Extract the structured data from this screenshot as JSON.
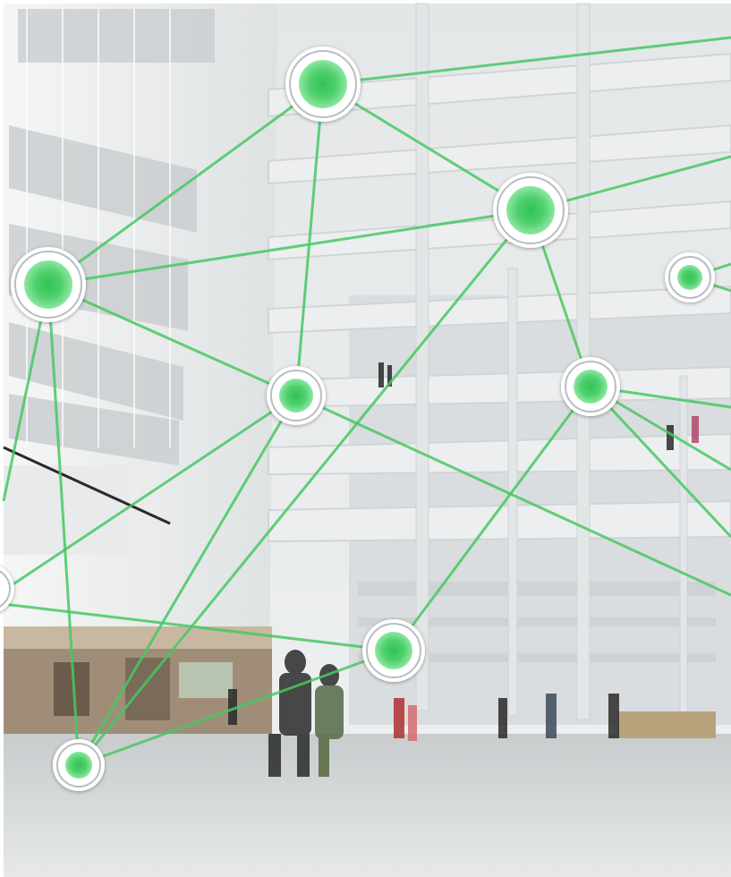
{
  "image": {
    "subject": "atrium-network-overlay",
    "colors": {
      "frame": "#ffffff",
      "wall": "#f1f3f4",
      "sky": "#e9eced",
      "floor": "#d9dcdd",
      "node_green": "#3cc25c",
      "node_green_light": "#6fe08a",
      "link_green": "#46c862",
      "ring_white": "#ffffff",
      "ring_grey": "#b9bdbf"
    },
    "icons": [
      "network-node-icon",
      "connection-line-icon"
    ]
  }
}
